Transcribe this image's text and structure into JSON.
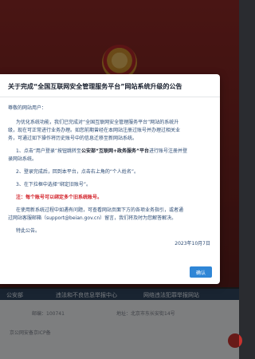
{
  "background": {
    "footer_bar": [
      "公安部",
      "违法和不良信息举报中心",
      "网络违法犯罪举报网站"
    ],
    "footer_line1": [
      "邮编：100741",
      "地址：北京市东长安街14号"
    ],
    "footer_line2": "京公网安备京ICP备"
  },
  "modal": {
    "title": "关于完成“全国互联网安全管理服务平台”网站系统升级的公告",
    "greeting": "尊敬的网站用户：",
    "intro_lines": [
      "为优化系统功能，我们已完成对“全国互联网安全管理服务平台”网站的系统升",
      "级，现在可正常进行业务办理。如您前期曾经在本网站注册过账号并办理过相关业",
      "务，可通过如下操作将历史账号中的信息迁移至新网站系统。"
    ],
    "step1_prefix": "1、点击“用户登录”按钮跳转至",
    "step1_bold": "公安部“互联网+政务服务”平台",
    "step1_suffix": "进行账号注册并登",
    "step1_line2": "录网站系统。",
    "step2": "2、登录完成后，回到本平台，点击右上角的“个人姓名”。",
    "step3": "3、在下拉框中选择“绑定旧账号”。",
    "note": "注：每个账号可以绑定多个旧系统账号。",
    "help_lines": [
      "在使用新系统过程中如遇有问题，可查看网站页面下方的各项业务指引，或者通",
      "过网站客服邮箱（support@beian.gov.cn）留言，我们将及时为您解答解决。"
    ],
    "closing": "特此公告。",
    "date": "2023年10月7日",
    "confirm_label": "确认"
  }
}
